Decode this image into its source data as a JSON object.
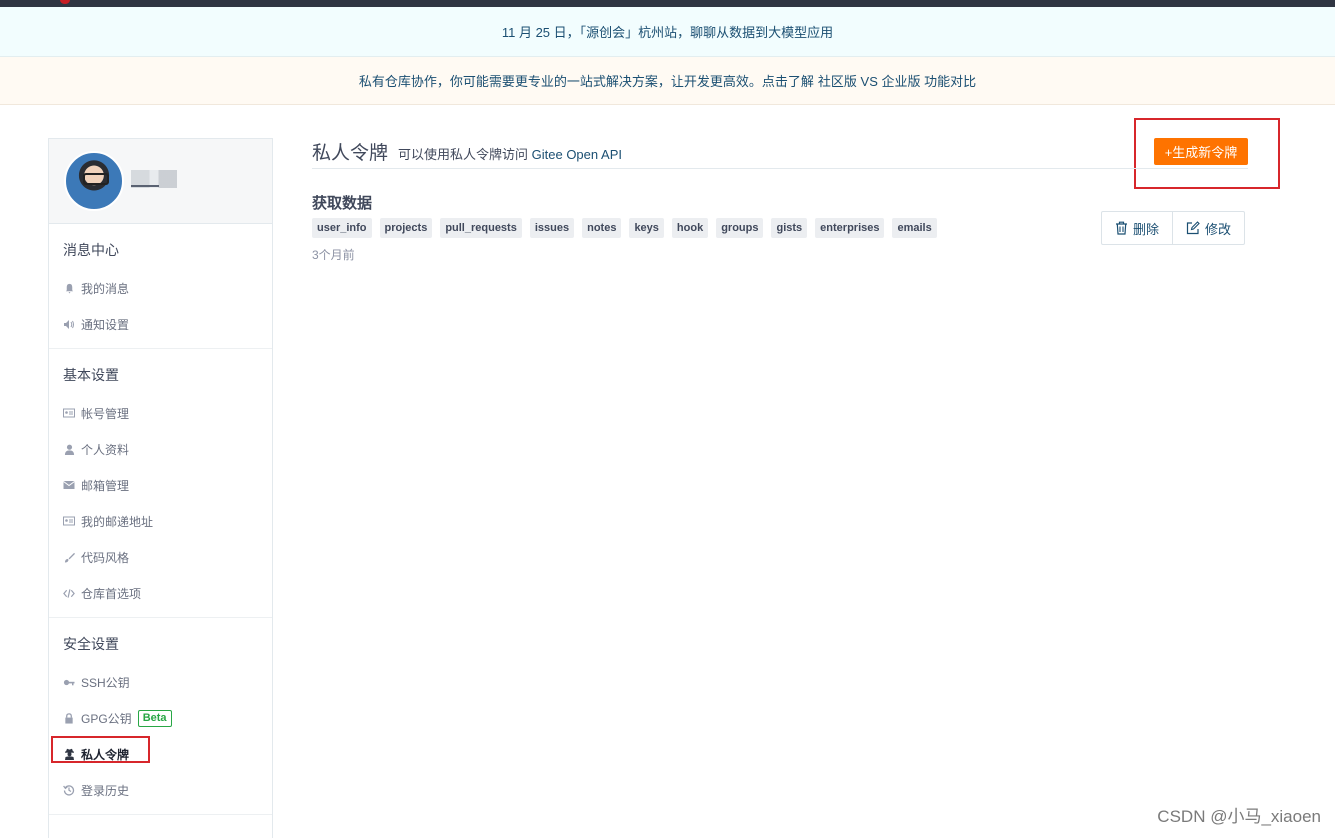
{
  "banners": {
    "event": "11 月 25 日，「源创会」杭州站，聊聊从数据到大模型应用",
    "promo_text": "私有仓库协作，你可能需要更专业的一站式解决方案，让开发更高效。点击了解",
    "promo_link": "社区版 VS 企业版 功能对比"
  },
  "sidebar": {
    "groups": [
      {
        "title": "消息中心",
        "items": [
          {
            "label": "我的消息",
            "icon": "bell-icon"
          },
          {
            "label": "通知设置",
            "icon": "speaker-icon"
          }
        ]
      },
      {
        "title": "基本设置",
        "items": [
          {
            "label": "帐号管理",
            "icon": "id-card-icon"
          },
          {
            "label": "个人资料",
            "icon": "user-icon"
          },
          {
            "label": "邮箱管理",
            "icon": "mail-icon"
          },
          {
            "label": "我的邮递地址",
            "icon": "address-card-icon"
          },
          {
            "label": "代码风格",
            "icon": "brush-icon"
          },
          {
            "label": "仓库首选项",
            "icon": "code-icon"
          }
        ]
      },
      {
        "title": "安全设置",
        "items": [
          {
            "label": "SSH公钥",
            "icon": "key-icon"
          },
          {
            "label": "GPG公钥",
            "icon": "lock-icon",
            "badge": "Beta"
          },
          {
            "label": "私人令牌",
            "icon": "user-secret-icon",
            "active": true
          },
          {
            "label": "登录历史",
            "icon": "history-icon"
          }
        ]
      }
    ]
  },
  "main": {
    "title": "私人令牌",
    "subtitle_prefix": "可以使用私人令牌访问",
    "subtitle_link": "Gitee Open API",
    "generate_button": "+生成新令牌",
    "token": {
      "name": "获取数据",
      "scopes": [
        "user_info",
        "projects",
        "pull_requests",
        "issues",
        "notes",
        "keys",
        "hook",
        "groups",
        "gists",
        "enterprises",
        "emails"
      ],
      "time": "3个月前",
      "delete_label": "删除",
      "edit_label": "修改"
    }
  },
  "watermark": "CSDN @小马_xiaoen",
  "colors": {
    "accent_orange": "#fe7300",
    "link_blue": "#1b4f72",
    "highlight_red": "#d7262b",
    "beta_green": "#28a745"
  }
}
